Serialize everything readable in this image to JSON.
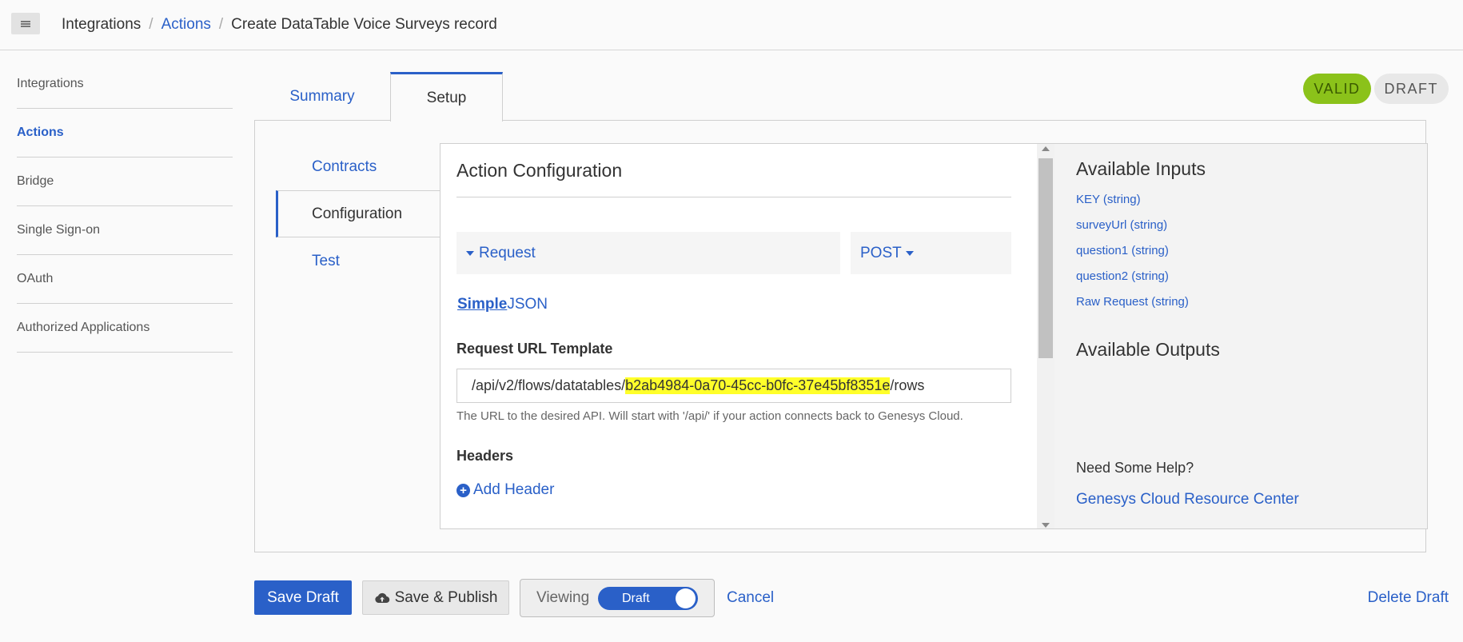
{
  "breadcrumb": {
    "items": [
      "Integrations",
      "Actions",
      "Create DataTable Voice Surveys record"
    ],
    "separator": "/"
  },
  "sidebar": {
    "items": [
      {
        "label": "Integrations",
        "active": false
      },
      {
        "label": "Actions",
        "active": true
      },
      {
        "label": "Bridge",
        "active": false
      },
      {
        "label": "Single Sign-on",
        "active": false
      },
      {
        "label": "OAuth",
        "active": false
      },
      {
        "label": "Authorized Applications",
        "active": false
      }
    ]
  },
  "tabs": {
    "items": [
      {
        "label": "Summary",
        "active": false
      },
      {
        "label": "Setup",
        "active": true
      }
    ]
  },
  "status": {
    "valid": "VALID",
    "draft": "DRAFT",
    "valid_color": "#8bc21a"
  },
  "subnav": {
    "items": [
      {
        "label": "Contracts",
        "active": false
      },
      {
        "label": "Configuration",
        "active": true
      },
      {
        "label": "Test",
        "active": false
      }
    ]
  },
  "config": {
    "title": "Action Configuration",
    "request_label": "Request",
    "method": "POST",
    "mode_simple": "Simple",
    "mode_json": "JSON",
    "url_label": "Request URL Template",
    "url_prefix": "/api/v2/flows/datatables/",
    "url_highlight": "b2ab4984-0a70-45cc-b0fc-37e45bf8351e",
    "url_suffix": "/rows",
    "url_help": "The URL to the desired API. Will start with '/api/' if your action connects back to Genesys Cloud.",
    "headers_label": "Headers",
    "add_header": "Add Header"
  },
  "side_info": {
    "inputs_title": "Available Inputs",
    "inputs": [
      "KEY (string)",
      "surveyUrl (string)",
      "question1 (string)",
      "question2 (string)",
      "Raw Request (string)"
    ],
    "outputs_title": "Available Outputs",
    "help_title": "Need Some Help?",
    "help_link": "Genesys Cloud Resource Center"
  },
  "footer": {
    "save_draft": "Save Draft",
    "save_publish": "Save & Publish",
    "viewing_label": "Viewing",
    "toggle_label": "Draft",
    "cancel": "Cancel",
    "delete_draft": "Delete Draft"
  },
  "colors": {
    "accent": "#2a60c8",
    "highlight": "#ffff2a"
  }
}
